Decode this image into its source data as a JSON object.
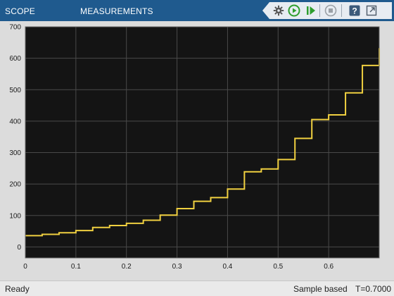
{
  "tabs": [
    {
      "label": "SCOPE"
    },
    {
      "label": "MEASUREMENTS"
    }
  ],
  "toolbar": {
    "icons": [
      "settings-gear-icon",
      "run-icon",
      "step-forward-icon",
      "stop-icon",
      "help-icon",
      "undock-icon"
    ],
    "colors": {
      "run": "#2e9e2e",
      "step": "#2e9e2e",
      "stop": "#9aa0a6",
      "help": "#3c5a7a"
    }
  },
  "status": {
    "left": "Ready",
    "mode": "Sample based",
    "time": "T=0.7000"
  },
  "colors": {
    "tabbar": "#1f5a8e",
    "plot_bg": "#141414",
    "grid": "#4a4a4a",
    "trace": "#f0d040"
  },
  "chart_data": {
    "type": "line",
    "step": true,
    "series": [
      {
        "x": [
          0,
          0.0333,
          0.0667,
          0.1,
          0.1333,
          0.1667,
          0.2,
          0.2333,
          0.2667,
          0.3,
          0.3333,
          0.3667,
          0.4,
          0.4333,
          0.4667,
          0.5,
          0.5333,
          0.5667,
          0.6,
          0.6333,
          0.6667,
          0.7
        ],
        "values": [
          36,
          40,
          45,
          52,
          62,
          68,
          75,
          85,
          101,
          122,
          145,
          157,
          184,
          239,
          248,
          278,
          345,
          405,
          420,
          490,
          577,
          632
        ]
      }
    ],
    "xlim": [
      0,
      0.7
    ],
    "ylim": [
      -35,
      700
    ],
    "xticks": [
      "0",
      "0.1",
      "0.2",
      "0.3",
      "0.4",
      "0.5",
      "0.6"
    ],
    "yticks": [
      "0",
      "100",
      "200",
      "300",
      "400",
      "500",
      "600",
      "700"
    ],
    "grid": true
  }
}
